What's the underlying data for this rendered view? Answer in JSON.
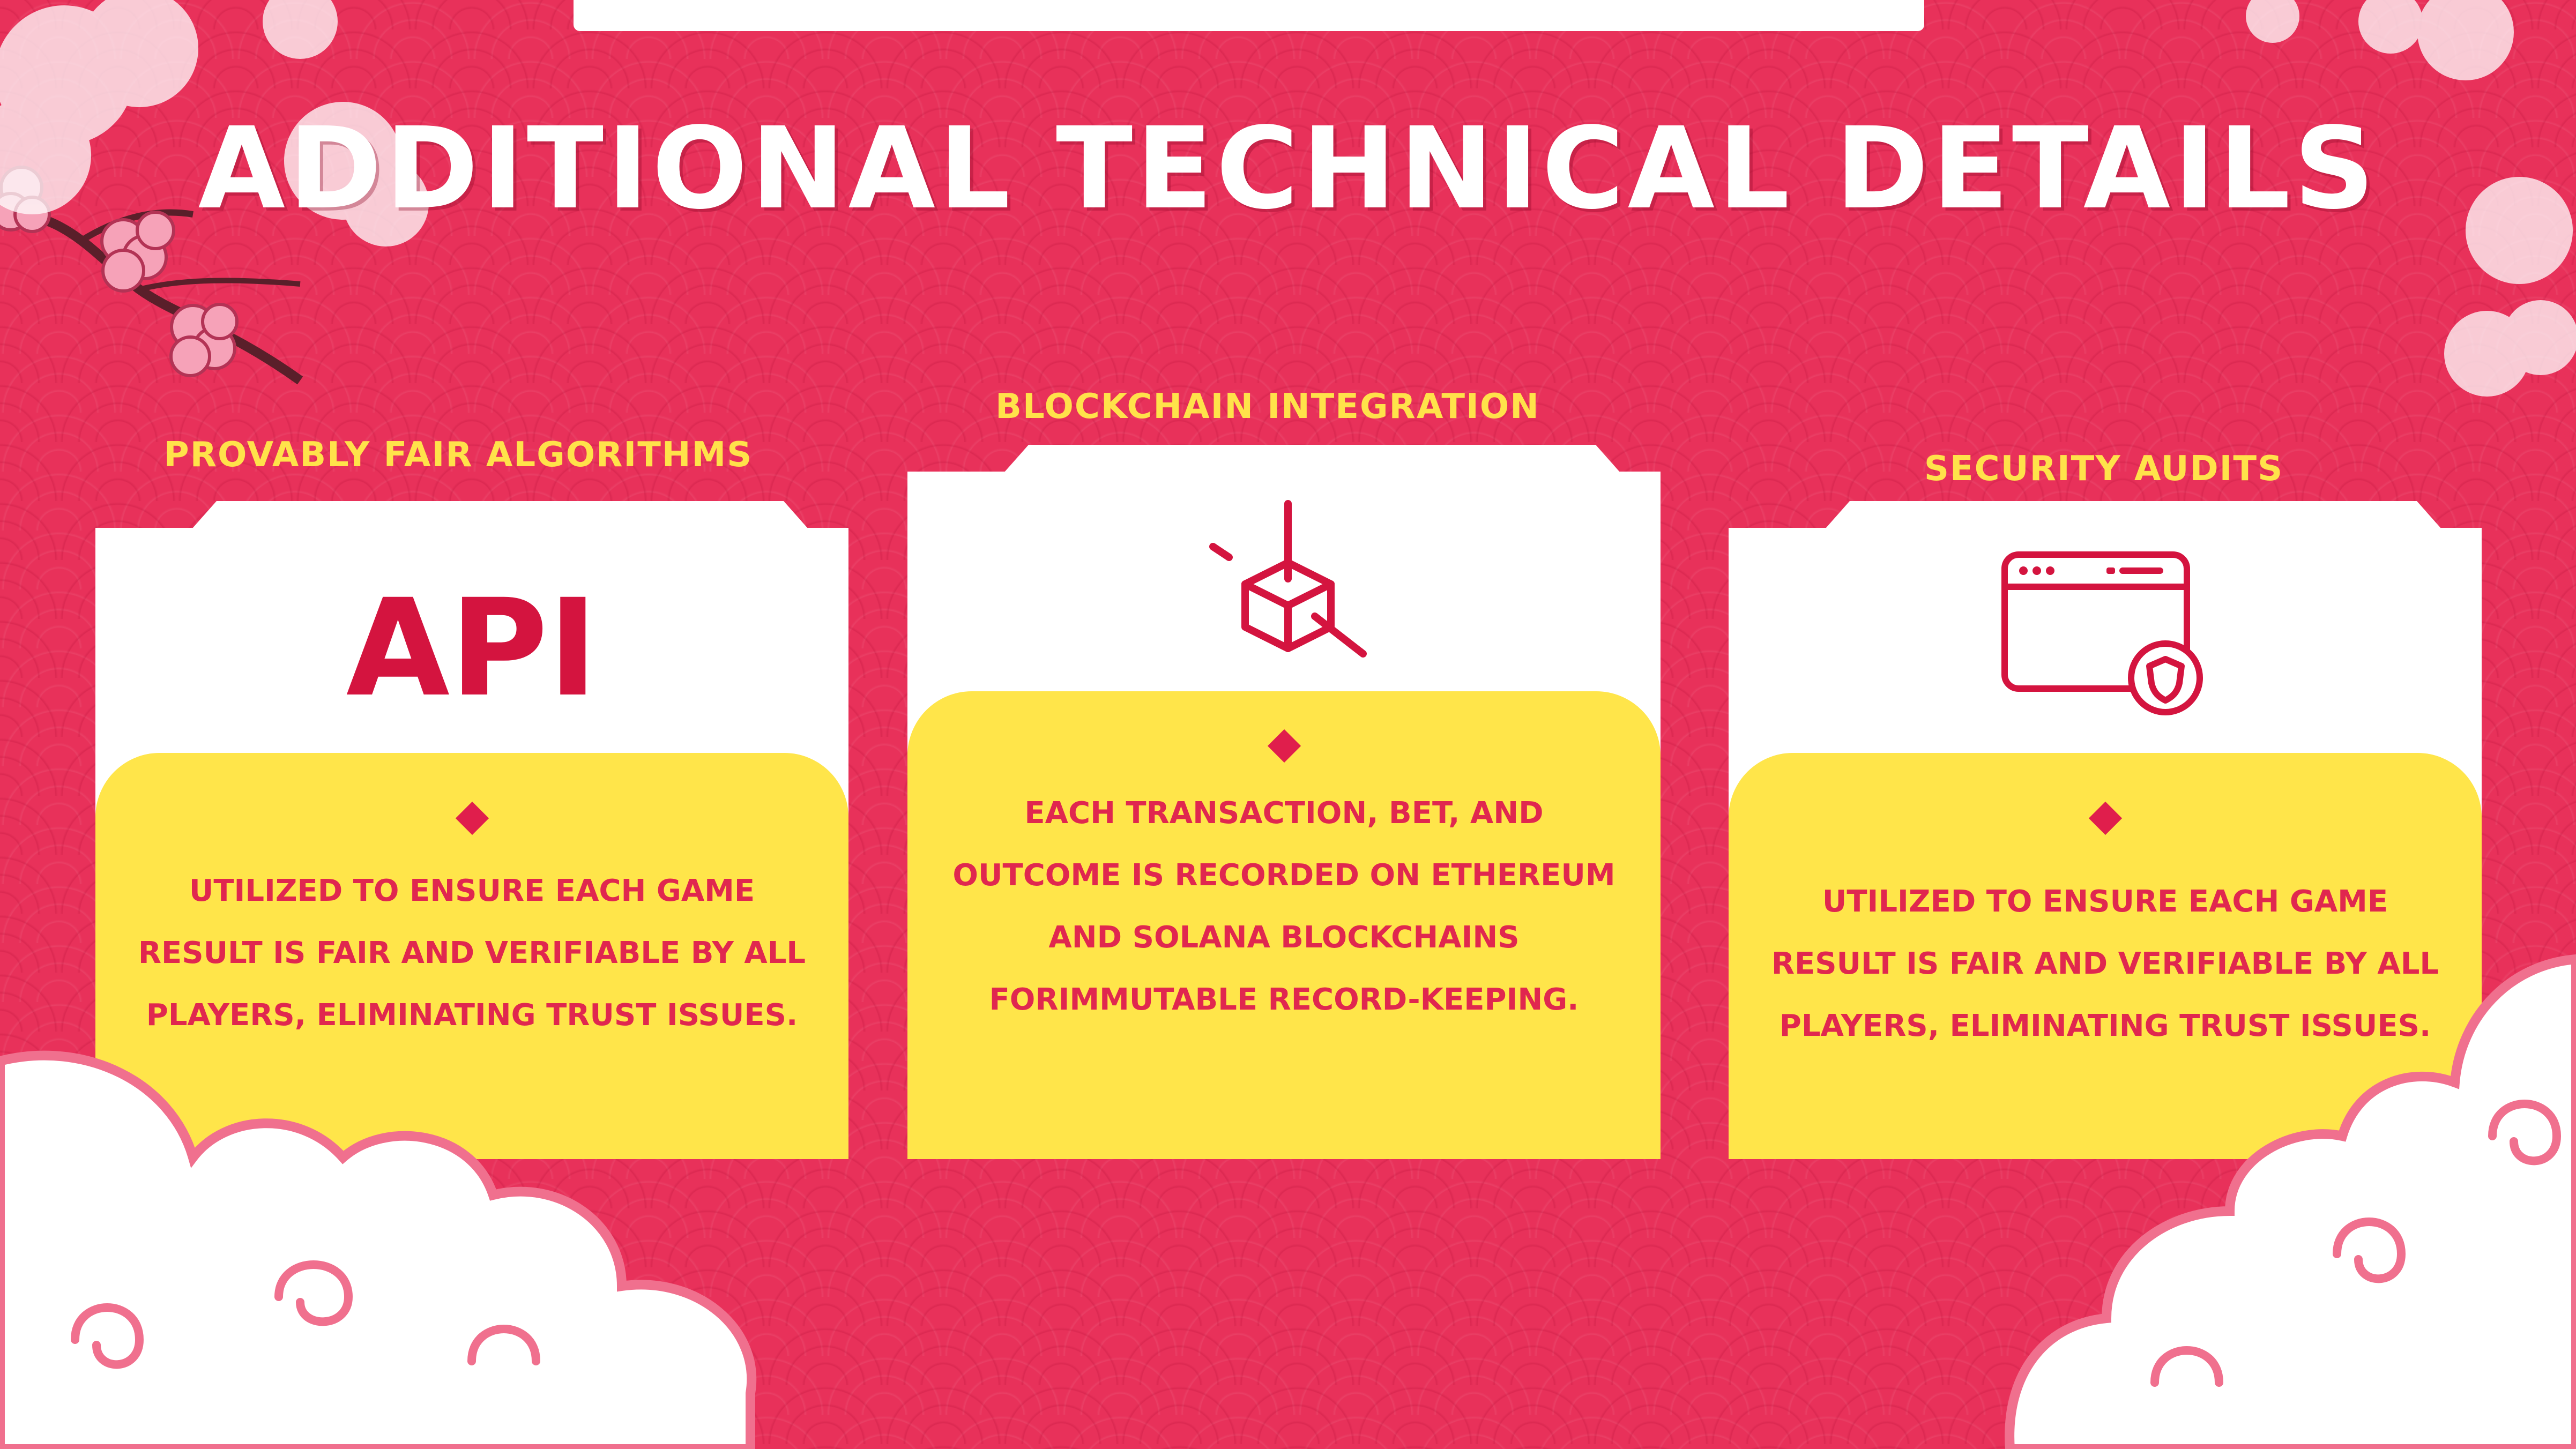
{
  "title": "ADDITIONAL TECHNICAL DETAILS",
  "colors": {
    "background": "#e8315a",
    "accent_yellow": "#ffe54a",
    "label_yellow": "#ffe24a",
    "text_red": "#e0274f",
    "white": "#ffffff"
  },
  "cards": [
    {
      "label": "PROVABLY FAIR ALGORITHMS",
      "icon_text": "API",
      "icon": "api-text-icon",
      "description": "UTILIZED TO ENSURE EACH GAME RESULT IS FAIR AND VERIFIABLE BY ALL PLAYERS, ELIMINATING TRUST ISSUES."
    },
    {
      "label": "BLOCKCHAIN INTEGRATION",
      "icon": "blockchain-cube-icon",
      "description": "EACH TRANSACTION, BET, AND OUTCOME IS RECORDED ON ETHEREUM AND SOLANA BLOCKCHAINS FORIMMUTABLE RECORD-KEEPING."
    },
    {
      "label": "SECURITY AUDITS",
      "icon": "secure-browser-shield-icon",
      "description": "UTILIZED TO ENSURE EACH GAME RESULT IS FAIR AND VERIFIABLE BY ALL PLAYERS, ELIMINATING TRUST ISSUES."
    }
  ]
}
